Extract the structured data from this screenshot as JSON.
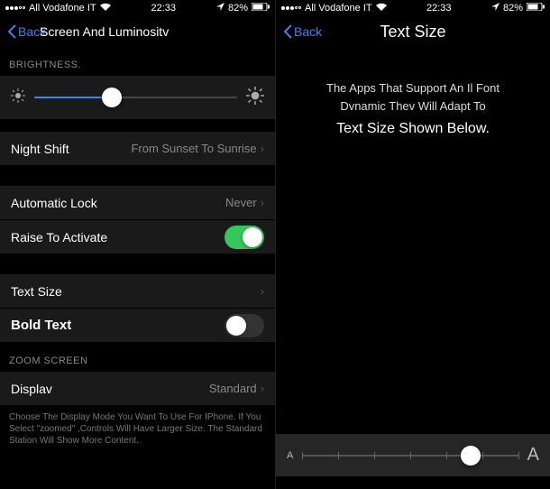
{
  "status": {
    "carrier": "All Vodafone IT",
    "time": "22:33",
    "battery": "82%"
  },
  "left": {
    "nav_back": "Back",
    "nav_title": "Screen And Luminositv",
    "sections": {
      "brightness_header": "BRIGHTNESS.",
      "night_shift_label": "Night Shift",
      "night_shift_value": "From Sunset To Sunrise",
      "auto_lock_label": "Automatic Lock",
      "auto_lock_value": "Never",
      "raise_label": "Raise To Activate",
      "text_size_label": "Text Size",
      "bold_text_label": "Bold Text",
      "zoom_header": "ZOOM SCREEN",
      "display_label": "Displav",
      "display_value": "Standard",
      "zoom_footer": "Choose The Display Mode You Want To Use For IPhone. If You Select \"zoomed\" ,Controls Will Have Larger Size. The Standard Station Will Show More Content."
    },
    "brightness_slider": {
      "value_pct": 38
    },
    "toggles": {
      "raise": true,
      "bold": false
    }
  },
  "right": {
    "nav_back": "Back",
    "nav_title": "Text Size",
    "info_line1": "The Apps That Support An Il Font",
    "info_line2": "Dvnamic Thev Will Adapt To",
    "info_line3": "Text Size Shown Below.",
    "slider": {
      "value_pct": 78,
      "ticks": 7,
      "small_label": "A",
      "large_label": "A"
    }
  }
}
